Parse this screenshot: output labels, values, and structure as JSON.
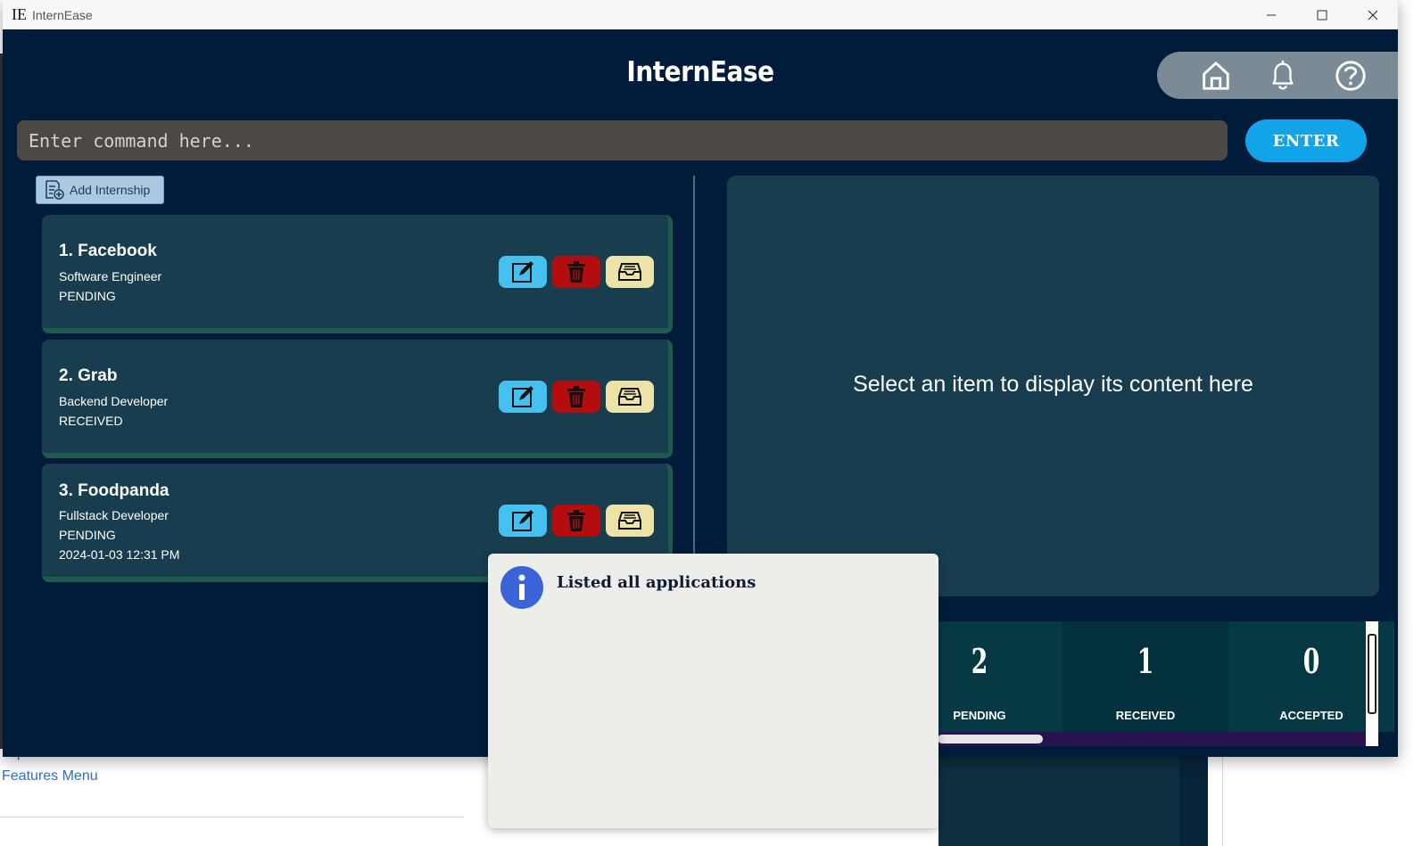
{
  "background": {
    "links": [
      "Top of Section",
      "Features Menu"
    ]
  },
  "window": {
    "title_logo": "IE",
    "title_text": "InternEase",
    "controls": [
      "minimize",
      "maximize",
      "close"
    ]
  },
  "app": {
    "title": "InternEase",
    "nav_icons": [
      "home-icon",
      "bell-icon",
      "help-icon"
    ]
  },
  "command": {
    "placeholder": "Enter command here...",
    "value": "",
    "enter_label": "ENTER"
  },
  "add_button_label": "Add Internship",
  "internships": [
    {
      "title": "1.  Facebook",
      "role": "Software Engineer",
      "status": "PENDING",
      "date": ""
    },
    {
      "title": "2.  Grab",
      "role": "Backend Developer",
      "status": "RECEIVED",
      "date": ""
    },
    {
      "title": "3.  Foodpanda",
      "role": "Fullstack Developer",
      "status": "PENDING",
      "date": "2024-01-03 12:31 PM"
    }
  ],
  "detail": {
    "placeholder": "Select an item to display its content here"
  },
  "stats": [
    {
      "count": "2",
      "label": "PENDING"
    },
    {
      "count": "1",
      "label": "RECEIVED"
    },
    {
      "count": "0",
      "label": "ACCEPTED"
    }
  ],
  "notification": {
    "message": "Listed all applications",
    "icon": "info-icon"
  },
  "colors": {
    "window_bg": "#011c3b",
    "card_bg": "#183d4e",
    "enter_btn": "#12a3e8",
    "edit_btn": "#45c1ef",
    "delete_btn": "#b50d0d",
    "archive_btn": "#ede3a8"
  }
}
